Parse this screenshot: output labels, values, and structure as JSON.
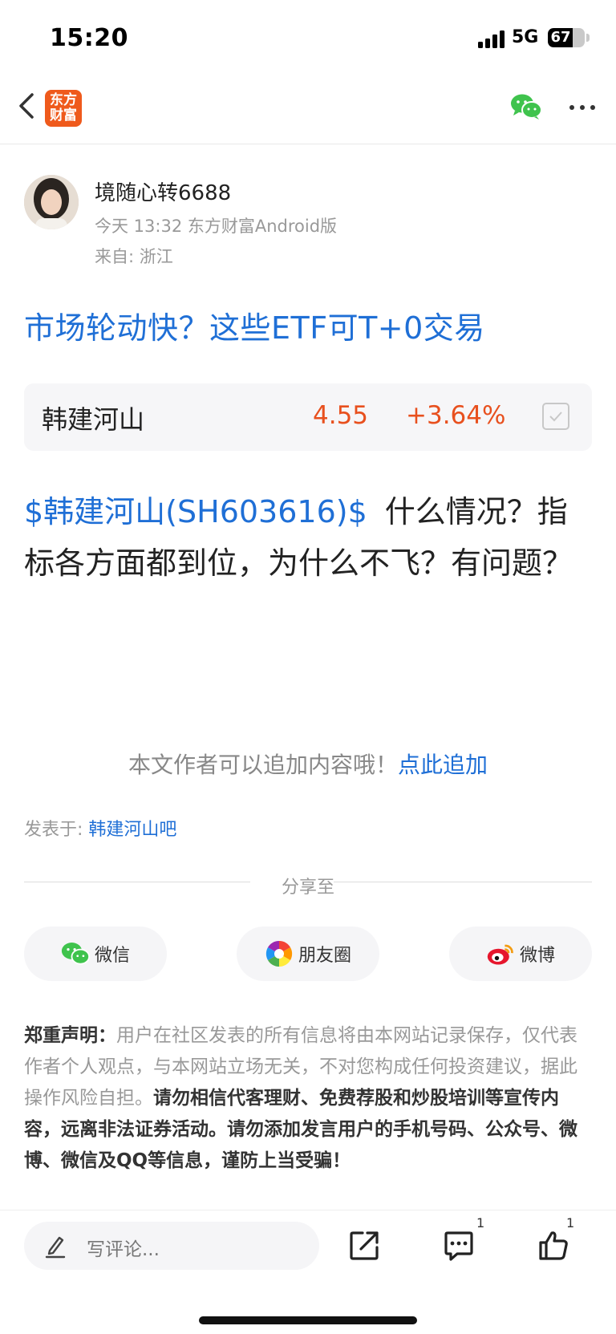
{
  "status_bar": {
    "time": "15:20",
    "network": "5G",
    "battery": "67",
    "battery_level": 0.67
  },
  "nav": {
    "logo_line1": "东方",
    "logo_line2": "财富",
    "icons": [
      "back-icon",
      "wechat-icon",
      "more-icon"
    ]
  },
  "author": {
    "name": "境随心转6688",
    "meta": "今天 13:32 东方财富Android版",
    "location": "来自: 浙江"
  },
  "post": {
    "title": "市场轮动快？这些ETF可T+0交易",
    "body_tag": "$韩建河山(SH603616)$",
    "body_text": "什么情况？指标各方面都到位，为什么不飞？有问题？"
  },
  "stock": {
    "name": "韩建河山",
    "price": "4.55",
    "change": "+3.64%"
  },
  "append": {
    "text": "本文作者可以追加内容哦！",
    "link": "点此追加"
  },
  "posted_in": {
    "label": "发表于: ",
    "bar": "韩建河山吧"
  },
  "share": {
    "label": "分享至",
    "buttons": [
      {
        "label": "微信",
        "icon": "wechat-icon"
      },
      {
        "label": "朋友圈",
        "icon": "moments-icon"
      },
      {
        "label": "微博",
        "icon": "weibo-icon"
      }
    ]
  },
  "disclaimer": {
    "heading": "郑重声明：",
    "normal": "用户在社区发表的所有信息将由本网站记录保存，仅代表作者个人观点，与本网站立场无关，不对您构成任何投资建议，据此操作风险自担。",
    "bold": "请勿相信代客理财、免费荐股和炒股培训等宣传内容，远离非法证券活动。请勿添加发言用户的手机号码、公众号、微博、微信及QQ等信息，谨防上当受骗！"
  },
  "bottom_bar": {
    "comment_placeholder": "写评论...",
    "comment_count": "1",
    "like_count": "1"
  },
  "colors": {
    "accent_blue": "#1f6fd6",
    "price_red": "#e8501e",
    "brand_orange": "#ef5a1c"
  }
}
